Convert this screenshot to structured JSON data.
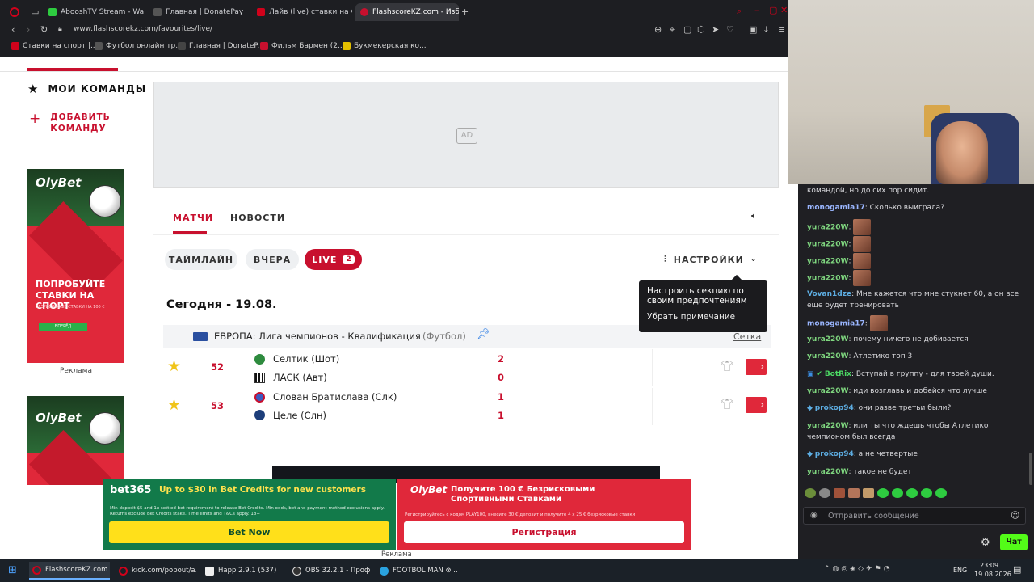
{
  "browser": {
    "tabs": [
      {
        "label": "AbooshTV Stream - Watch",
        "color": "#2ecc40"
      },
      {
        "label": "Главная | DonatePay",
        "color": "#444"
      },
      {
        "label": "Лайв (live) ставки на Футб",
        "color": "#d0021b"
      },
      {
        "label": "FlashscoreKZ.com - Избра",
        "color": "#c8102e"
      }
    ],
    "url": "www.flashscorekz.com/favourites/live/",
    "bookmarks": [
      {
        "label": "Ставки на спорт |...",
        "color": "#d0021b"
      },
      {
        "label": "Футбол онлайн тр...",
        "color": "#555"
      },
      {
        "label": "Главная | DonateP...",
        "color": "#444"
      },
      {
        "label": "Фильм Бармен (2...",
        "color": "#c8102e"
      },
      {
        "label": "Букмекерская ко...",
        "color": "#e5c100"
      }
    ]
  },
  "sidebar": {
    "my_teams": "МОИ КОМАНДЫ",
    "add_team_line1": "ДОБАВИТЬ",
    "add_team_line2": "КОМАНДУ",
    "ad_brand": "OlyBet",
    "ad_text_line1": "ПОПРОБУЙТЕ",
    "ad_text_line2": "СТАВКИ НА СПОРТ",
    "ad_text_small": "БЕЗРИСКОВЫЕ СТАВКИ НА 100 €",
    "ad_button": "ВПЕРЁД",
    "ad_caption": "Реклама",
    "ad2_brand": "OlyBet"
  },
  "ad_placeholder": "AD",
  "main": {
    "tabs": [
      "МАТЧИ",
      "НОВОСТИ"
    ],
    "filters": {
      "timeline": "ТАЙМЛАЙН",
      "yesterday": "ВЧЕРА",
      "live": "LIVE",
      "live_count": "2"
    },
    "settings": "НАСТРОЙКИ",
    "tooltip_text": "Настроить секцию по своим предпочтениям",
    "tooltip_dismiss": "Убрать примечание",
    "date": "Сегодня - 19.08.",
    "league": "ЕВРОПА: Лига чемпионов - Квалификация",
    "league_sport": "(Футбол)",
    "bracket": "Сетка",
    "matches": [
      {
        "minute": "52",
        "home": "Селтик (Шот)",
        "away": "ЛАСК (Авт)",
        "home_score": "2",
        "away_score": "0"
      },
      {
        "minute": "53",
        "home": "Слован Братислава (Слк)",
        "away": "Целе (Слн)",
        "home_score": "1",
        "away_score": "1"
      }
    ]
  },
  "bottom_ads": {
    "bet365_logo": "bet365",
    "bet365_title": "Up to $30 in Bet Credits for new customers",
    "bet365_small": "Min deposit $5 and 1x settled bet requirement to release Bet Credits. Min odds, bet and payment method exclusions apply. Returns exclude Bet Credits stake. Time limits and T&Cs apply. 18+",
    "bet365_button": "Bet Now",
    "olybet_logo": "OlyBet",
    "olybet_title": "Получите 100 € Безрисковыми Спортивными Ставками",
    "olybet_small": "Регистрируйтесь с кодом PLAY100, внесите 30 € депозит и получите 4 x 25 € безрисковые ставки",
    "olybet_button": "Регистрация",
    "caption": "Реклама"
  },
  "chat": {
    "messages": [
      {
        "user": "",
        "text": "командой, но до сих пор сидит.",
        "color": "#d8d8dc"
      },
      {
        "user": "monogamia17",
        "text": ": Сколько выиграла?",
        "color": "#9ab6ff"
      },
      {
        "user": "yura220W",
        "text": ":",
        "color": "#7fd67f",
        "emote": true
      },
      {
        "user": "yura220W",
        "text": ":",
        "color": "#7fd67f",
        "emote": true
      },
      {
        "user": "yura220W",
        "text": ":",
        "color": "#7fd67f",
        "emote": true
      },
      {
        "user": "yura220W",
        "text": ":",
        "color": "#7fd67f",
        "emote": true
      },
      {
        "user": "Vovan1dze",
        "text": ": Мне кажется что мне стукнет 60, а он все еще будет тренировать",
        "color": "#5dade2"
      },
      {
        "user": "monogamia17",
        "text": ":",
        "color": "#9ab6ff",
        "emote": true
      },
      {
        "user": "yura220W",
        "text": ": почему ничего не добивается",
        "color": "#7fd67f"
      },
      {
        "user": "yura220W",
        "text": ": Атлетико топ 3",
        "color": "#7fd67f"
      },
      {
        "user": "BotRix",
        "text": ": Вступай в группу - для твоей души.",
        "color": "#4cd964"
      },
      {
        "user": "yura220W",
        "text": ": иди возглавь и добейся что лучше",
        "color": "#7fd67f"
      },
      {
        "user": "prokop94",
        "text": ": они разве третьи были?",
        "color": "#5dade2"
      },
      {
        "user": "yura220W",
        "text": ": или ты что ждешь чтобы Атлетико чемпионом был всегда",
        "color": "#7fd67f"
      },
      {
        "user": "prokop94",
        "text": ": а не четвертые",
        "color": "#5dade2"
      },
      {
        "user": "yura220W",
        "text": ": такое не будет",
        "color": "#7fd67f"
      }
    ],
    "input_placeholder": "Отправить сообщение",
    "chat_button": "Чат"
  },
  "taskbar": {
    "items": [
      "FlashscoreKZ.com ...",
      "kick.com/popout/a...",
      "Happ 2.9.1 (537)",
      "OBS 32.2.1 - Проф...",
      "FOOTBOL MAN ⊗ ..."
    ],
    "lang": "ENG",
    "time": "23:09",
    "date": "19.08.2026"
  }
}
